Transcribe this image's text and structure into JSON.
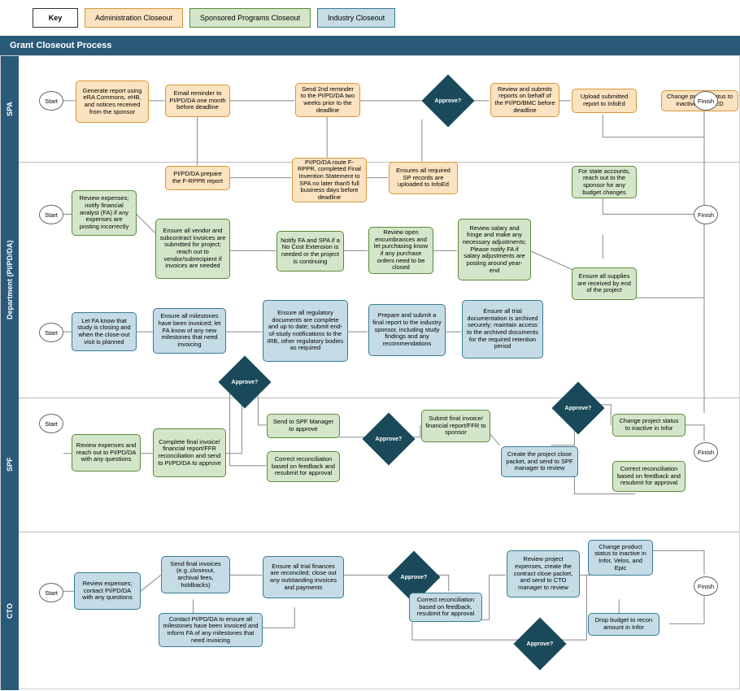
{
  "legend": {
    "key": "Key",
    "admin": "Administration Closeout",
    "sponsored": "Sponsored Programs Closeout",
    "industry": "Industry Closeout"
  },
  "title": "Grant Closeout Process",
  "lanes": {
    "spa": "SPA",
    "dept": "Department (PI/PD/DA)",
    "spf": "SPF",
    "cto": "CTO"
  },
  "terminals": {
    "start": "Start",
    "finish": "Finish"
  },
  "decisions": {
    "approve": "Approve?"
  },
  "spa": {
    "n1": "Generate report using eRA Commons, eHB, and notices received from the sponsor",
    "n2": "Email reminder to PI/PD/DA one month before deadline",
    "n3": "Send 2nd reminder to the PI/PD/DA two weeks prior to the deadline",
    "n4": "Review and submits reports on behalf of the PI/PD/BMC before deadline",
    "n5": "Upload submitted report to InfoEd",
    "n6": "Change project status to inactive in InfoED",
    "n7": "PI/PD/DA prepare the F-RPPR report",
    "n8": "PI/PD/DA route F-RPPR, completed Final Invention Statement to SPA no later than5 full business days before deadline",
    "n9": "Ensures all required SP records are uploaded to InfoEd"
  },
  "dept": {
    "g1": "Review expenses; notify financial analyst (FA)  if any expenses are posting incorrectly",
    "g2": "Ensure all vendor and subcontract invoices are submitted for project; reach out to vendor/subrecipient if invoices are needed",
    "g3": "Notify FA and SPA if a No Cost Extension is needed or the project is continuing",
    "g4": "Review open encumbrances and let purchasing know if any purchase orders need to be closed",
    "g5": "Review salary and fringe and make any necessary adjustments; Please notify FA if salary adjustments are posting around year-end",
    "g6": "For state accounts, reach out to the sponsor for any budget changes",
    "g7": "Ensure all supplies are received by end of the project",
    "i1": "Let FA know that study is closing and when the close-out visit is planned",
    "i2": "Ensure all milestones have been invoiced; let FA know of any new milestones that need invoicing",
    "i3": "Ensure all regulatory documents are complete and up to date; submit end-of-study notifications to the IRB, other regulatory bodies as required",
    "i4": "Prepare and submit a final report to the industry sponsor, including study findings and any recommendations",
    "i5": "Ensure all trial documentation is archived securely; maintain access to the archived documents for the required retention period"
  },
  "spf": {
    "s1": "Review expenses and reach out to PI/PD/DA with any questions",
    "s2": "Complete final invoice/ financial report/FFR reconciliation and send to PI/PD/DA to approve",
    "s3a": "Send to SPF Manager to approve",
    "s3b": "Correct reconciliation based on feedback and resubmit for approval",
    "s4": "Submit final invoice/ financial report/FFR to sponsor",
    "s5": "Create the  project close packet, and send to SPF manager to review",
    "s6a": "Change project status to inactive in Infor",
    "s6b": "Correct reconciliation based on feedback and resubmit for approval"
  },
  "cto": {
    "c1": "Review expenses; contact PI/PD/DA with any questions",
    "c2": "Send final invoices (e.g.,closeout, archival fees, holdbacks)",
    "c2b": "Contact PI/PD/DA to ensure all milestones have been invoiced and inform FA of any milestones that need invoicing",
    "c3": "Ensure all trial finances are reconciled; close out any outstanding invoices and payments",
    "c4": "Correct reconciliation based on feedback, resubmit for approval",
    "c5": "Review project expenses, create the contract close packet, and send to CTO manager to review",
    "c6": "Change product status to inactive in Infor, Velos, and Epic",
    "c7": "Drop budget to recon amount in Infor"
  }
}
